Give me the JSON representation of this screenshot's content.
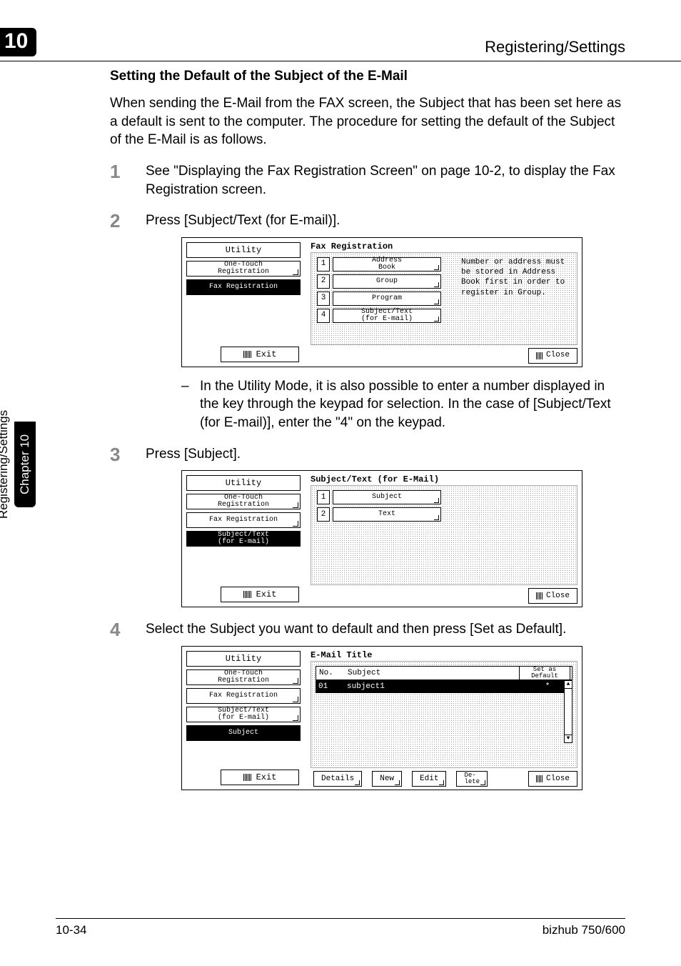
{
  "header": {
    "chapnum": "10",
    "title": "Registering/Settings"
  },
  "sidebar": {
    "chapter": "Chapter 10",
    "section": "Registering/Settings"
  },
  "subheading": "Setting the Default of the Subject of the E-Mail",
  "intro": "When sending the E-Mail from the FAX screen, the Subject that has been set here as a default is sent to the computer. The procedure for setting the default of the Subject of the E-Mail is as follows.",
  "steps": {
    "s1": "See \"Displaying the Fax Registration Screen\" on page 10-2, to display the Fax Registration screen.",
    "s2": "Press [Subject/Text (for E-mail)].",
    "s3": "Press [Subject].",
    "s4": "Select the Subject you want to default and then press [Set as Default]."
  },
  "note2": "In the Utility Mode, it is also possible to enter a number displayed in the key through the keypad for selection. In the case of [Subject/Text (for E-mail)], enter the \"4\" on the keypad.",
  "ui_common": {
    "utility": "Utility",
    "exit": "Exit",
    "close": "Close",
    "crumb_onetouch": "One-Touch\nRegistration",
    "crumb_faxreg": "Fax Registration",
    "crumb_subjtext": "Subject/Text\n(for E-mail)",
    "crumb_subject": "Subject"
  },
  "screen1": {
    "title": "Fax Registration",
    "items": [
      {
        "n": "1",
        "label": "Address\nBook"
      },
      {
        "n": "2",
        "label": "Group"
      },
      {
        "n": "3",
        "label": "Program"
      },
      {
        "n": "4",
        "label": "Subject/Text\n(for E-mail)"
      }
    ],
    "info": "Number or address must be stored in Address Book first in order to register in Group."
  },
  "screen2": {
    "title": "Subject/Text (for E-Mail)",
    "items": [
      {
        "n": "1",
        "label": "Subject"
      },
      {
        "n": "2",
        "label": "Text"
      }
    ]
  },
  "screen3": {
    "title": "E-Mail Title",
    "colhdr": {
      "no": "No.",
      "subject": "Subject",
      "setdef": "Set as\nDefault"
    },
    "row": {
      "no": "01",
      "subject": "subject1",
      "mark": "*"
    },
    "buttons": {
      "details": "Details",
      "new": "New",
      "edit": "Edit",
      "delete": "De-\nlete"
    }
  },
  "footer": {
    "pagenum": "10-34",
    "model": "bizhub 750/600"
  }
}
